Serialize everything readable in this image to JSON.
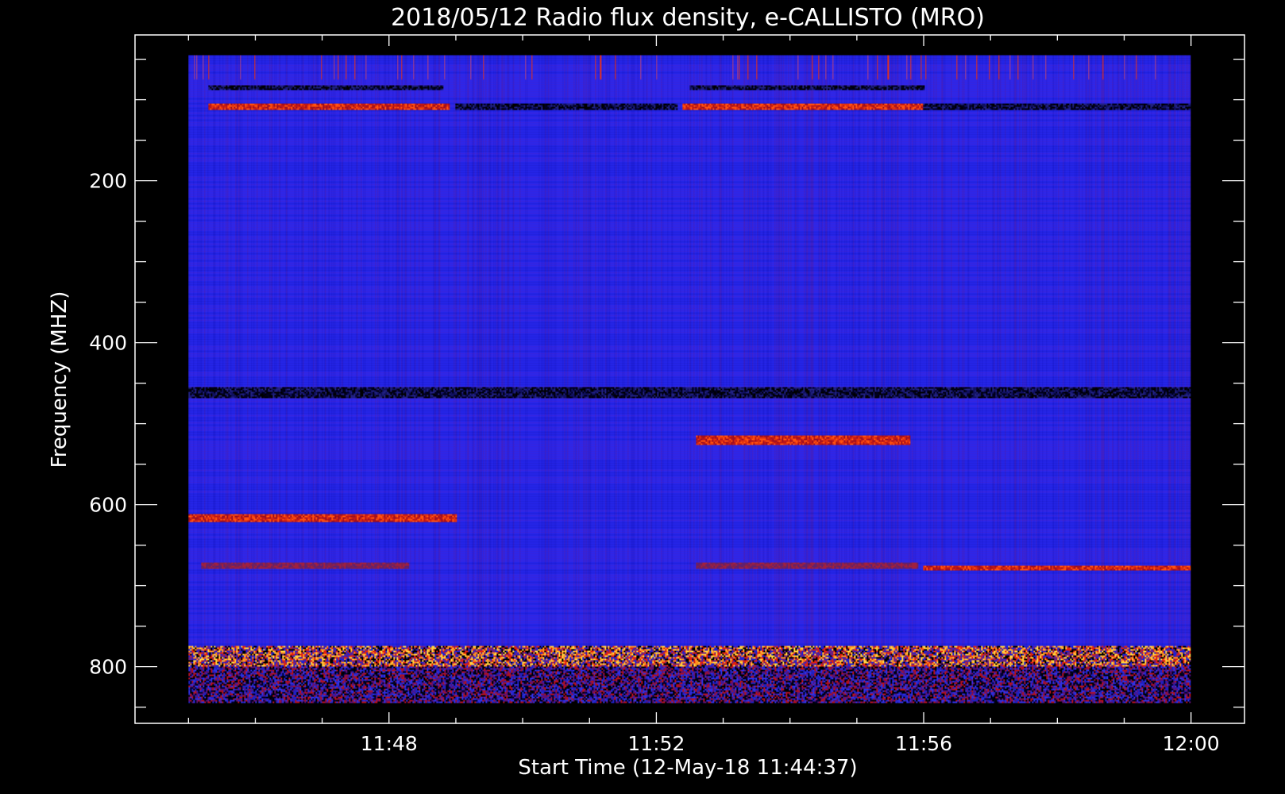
{
  "chart_data": {
    "type": "heatmap",
    "title": "2018/05/12  Radio flux density, e-CALLISTO (MRO)",
    "xlabel": "Start Time (12-May-18 11:44:37)",
    "ylabel": "Frequency (MHZ)",
    "x_ticks": [
      "11:48",
      "11:52",
      "11:56",
      "12:00"
    ],
    "x_tick_minutes": [
      48,
      52,
      56,
      60
    ],
    "x_minor_step_minutes": 1,
    "y_ticks": [
      200,
      400,
      600,
      800
    ],
    "y_minor_step": 50,
    "x_range_minutes": [
      44.2,
      60.8
    ],
    "y_range_mhz": [
      20,
      870
    ],
    "data_x_range_minutes": [
      45,
      60
    ],
    "data_y_range_mhz": [
      45,
      845
    ],
    "colormap": [
      "#000000",
      "#0000ff",
      "#7a1a8a",
      "#d01010",
      "#ff8c00",
      "#ffff00"
    ],
    "background_color": "#2828f0",
    "bands": [
      {
        "f0": 105,
        "f1": 112,
        "t0": 45.3,
        "t1": 48.9,
        "level": "red"
      },
      {
        "f0": 105,
        "f1": 112,
        "t0": 52.4,
        "t1": 56.0,
        "level": "red"
      },
      {
        "f0": 83,
        "f1": 88,
        "t0": 45.3,
        "t1": 48.8,
        "level": "dark"
      },
      {
        "f0": 83,
        "f1": 88,
        "t0": 52.5,
        "t1": 56.0,
        "level": "dark"
      },
      {
        "f0": 105,
        "f1": 112,
        "t0": 49.0,
        "t1": 52.3,
        "level": "dark"
      },
      {
        "f0": 105,
        "f1": 112,
        "t0": 56.0,
        "t1": 60.0,
        "level": "dark"
      },
      {
        "f0": 455,
        "f1": 468,
        "t0": 45.0,
        "t1": 60.0,
        "level": "dark"
      },
      {
        "f0": 515,
        "f1": 525,
        "t0": 52.6,
        "t1": 55.8,
        "level": "red"
      },
      {
        "f0": 612,
        "f1": 620,
        "t0": 45.0,
        "t1": 49.0,
        "level": "red"
      },
      {
        "f0": 672,
        "f1": 678,
        "t0": 45.2,
        "t1": 48.3,
        "level": "purple"
      },
      {
        "f0": 672,
        "f1": 678,
        "t0": 52.6,
        "t1": 55.9,
        "level": "purple"
      },
      {
        "f0": 676,
        "f1": 680,
        "t0": 56.0,
        "t1": 60.0,
        "level": "red"
      },
      {
        "f0": 775,
        "f1": 800,
        "t0": 45.0,
        "t1": 60.0,
        "level": "mixed-hot"
      },
      {
        "f0": 800,
        "f1": 845,
        "t0": 45.0,
        "t1": 60.0,
        "level": "mixed-dark"
      }
    ]
  }
}
